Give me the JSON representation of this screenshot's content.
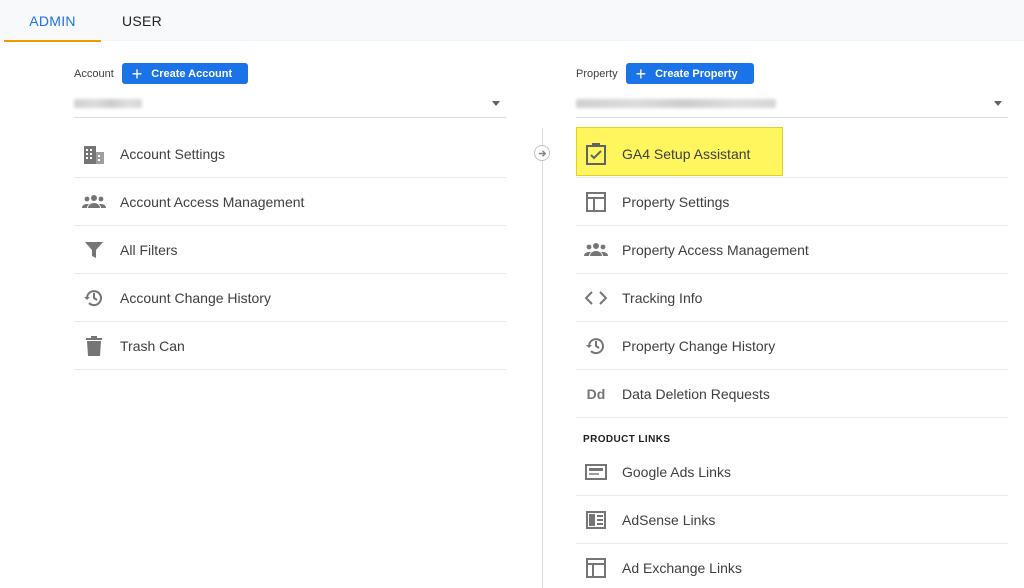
{
  "tabs": [
    {
      "label": "ADMIN",
      "active": true
    },
    {
      "label": "USER",
      "active": false
    }
  ],
  "account": {
    "label": "Account",
    "create_label": "Create Account",
    "selected_value": "",
    "menu": [
      {
        "label": "Account Settings",
        "icon": "building-icon"
      },
      {
        "label": "Account Access Management",
        "icon": "people-icon"
      },
      {
        "label": "All Filters",
        "icon": "filter-icon"
      },
      {
        "label": "Account Change History",
        "icon": "history-icon"
      },
      {
        "label": "Trash Can",
        "icon": "trash-icon"
      }
    ]
  },
  "property": {
    "label": "Property",
    "create_label": "Create Property",
    "selected_value": "",
    "menu": [
      {
        "label": "GA4 Setup Assistant",
        "icon": "checkbox-clipboard-icon",
        "highlighted": true
      },
      {
        "label": "Property Settings",
        "icon": "layout-icon"
      },
      {
        "label": "Property Access Management",
        "icon": "people-icon"
      },
      {
        "label": "Tracking Info",
        "icon": "code-icon"
      },
      {
        "label": "Property Change History",
        "icon": "history-icon"
      },
      {
        "label": "Data Deletion Requests",
        "icon": "dd-icon"
      }
    ],
    "product_links_label": "PRODUCT LINKS",
    "product_links": [
      {
        "label": "Google Ads Links",
        "icon": "ads-icon"
      },
      {
        "label": "AdSense Links",
        "icon": "adsense-icon"
      },
      {
        "label": "Ad Exchange Links",
        "icon": "adexchange-icon"
      }
    ]
  },
  "colors": {
    "accent": "#1a73e8",
    "tab_indicator": "#f29900",
    "highlight": "#fff55c"
  }
}
